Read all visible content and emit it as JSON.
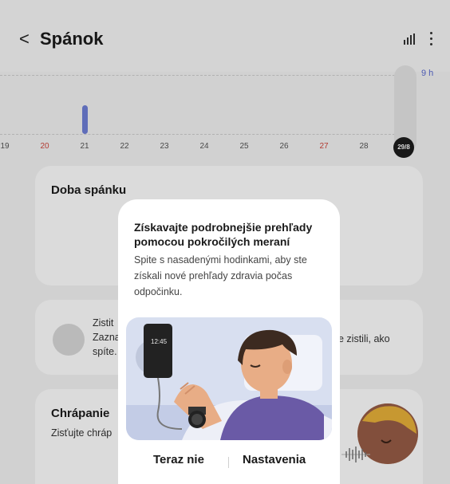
{
  "header": {
    "back_icon": "chevron-left-icon",
    "title": "Spánok",
    "chart_icon": "bar-chart-icon",
    "more_icon": "more-vertical-icon"
  },
  "chart_data": {
    "type": "bar",
    "categories": [
      "19",
      "20",
      "21",
      "22",
      "23",
      "24",
      "25",
      "26",
      "27",
      "28",
      "29/8"
    ],
    "values": [
      0,
      0,
      3.0,
      0,
      0,
      0,
      0,
      0,
      0,
      0,
      0
    ],
    "y_label": "9 h",
    "ylim": [
      0,
      9
    ],
    "highlighted_categories": [
      "20",
      "27"
    ],
    "selected_category": "29/8",
    "bar_color": "#6f7fd8"
  },
  "cards": {
    "sleep_duration": {
      "title": "Doba spánku"
    },
    "detect": {
      "line1": "Zistit",
      "line2": "Zazna",
      "line3": "spíte.",
      "right_text": "e zistili, ako"
    },
    "snoring": {
      "title": "Chrápanie",
      "text": "Zisťujte chráp"
    }
  },
  "dialog": {
    "title": "Získavajte podrobnejšie prehľady pomocou pokročilých meraní",
    "body": "Spite s nasadenými hodinkami, aby ste získali nové prehľady zdravia počas odpočinku.",
    "phone_time": "12:45",
    "cancel_label": "Teraz nie",
    "settings_label": "Nastavenia"
  }
}
